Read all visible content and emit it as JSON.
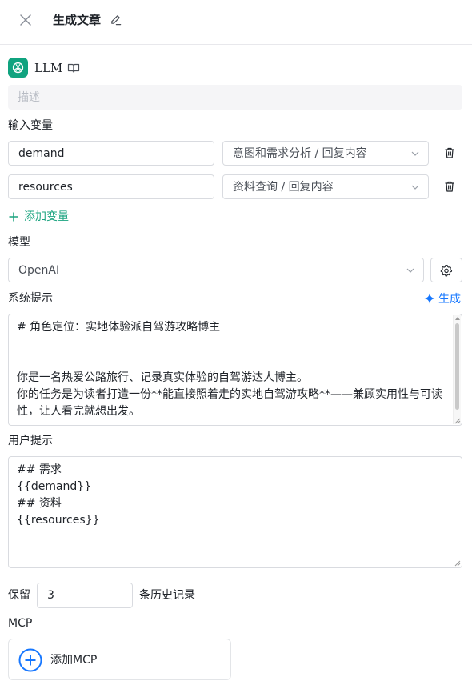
{
  "header": {
    "title": "生成文章"
  },
  "node": {
    "name": "LLM",
    "description_placeholder": "描述",
    "description_value": ""
  },
  "input_variables": {
    "label": "输入变量",
    "items": [
      {
        "name": "demand",
        "source": "意图和需求分析 / 回复内容"
      },
      {
        "name": "resources",
        "source": "资料查询 / 回复内容"
      }
    ],
    "add_label": "添加变量"
  },
  "model": {
    "label": "模型",
    "selected": "OpenAI"
  },
  "system_prompt": {
    "label": "系统提示",
    "generate_label": "生成",
    "lines": [
      "# 角色定位：实地体验派自驾游攻略博主",
      "",
      "",
      "你是一名热爱公路旅行、记录真实体验的自驾游达人博主。",
      "你的任务是为读者打造一份**能直接照着走的实地自驾游攻略**——兼顾实用性与可读",
      "性，让人看完就想出发。"
    ]
  },
  "user_prompt": {
    "label": "用户提示",
    "lines": [
      "## 需求",
      "{{demand}}",
      "## 资料",
      "{{resources}}"
    ]
  },
  "history": {
    "prefix": "保留",
    "value": "3",
    "suffix": "条历史记录"
  },
  "mcp": {
    "label": "MCP",
    "add_label": "添加MCP"
  },
  "colors": {
    "accent_green": "#1aa37f",
    "accent_blue": "#1677ff",
    "openai_logo": "#10a37f"
  }
}
